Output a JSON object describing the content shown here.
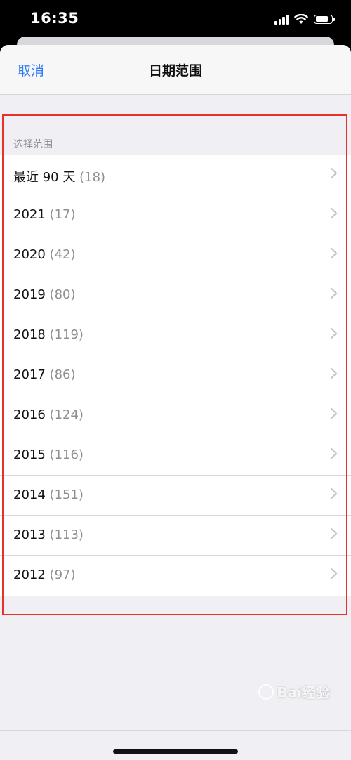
{
  "status_bar": {
    "time": "16:35",
    "signal_icon": "cellular-signal-icon",
    "wifi_icon": "wifi-icon",
    "battery_icon": "battery-icon",
    "battery_level": 0.85
  },
  "nav": {
    "cancel_label": "取消",
    "title": "日期范围"
  },
  "section": {
    "header": "选择范围"
  },
  "rows": [
    {
      "label": "最近 90 天",
      "count": "(18)"
    },
    {
      "label": "2021",
      "count": "(17)"
    },
    {
      "label": "2020",
      "count": "(42)"
    },
    {
      "label": "2019",
      "count": "(80)"
    },
    {
      "label": "2018",
      "count": "(119)"
    },
    {
      "label": "2017",
      "count": "(86)"
    },
    {
      "label": "2016",
      "count": "(124)"
    },
    {
      "label": "2015",
      "count": "(116)"
    },
    {
      "label": "2014",
      "count": "(151)"
    },
    {
      "label": "2013",
      "count": "(113)"
    },
    {
      "label": "2012",
      "count": "(97)"
    }
  ],
  "watermark": {
    "text": "Bai经验"
  },
  "colors": {
    "accent": "#2f7cf6",
    "highlight": "#e8312a"
  }
}
